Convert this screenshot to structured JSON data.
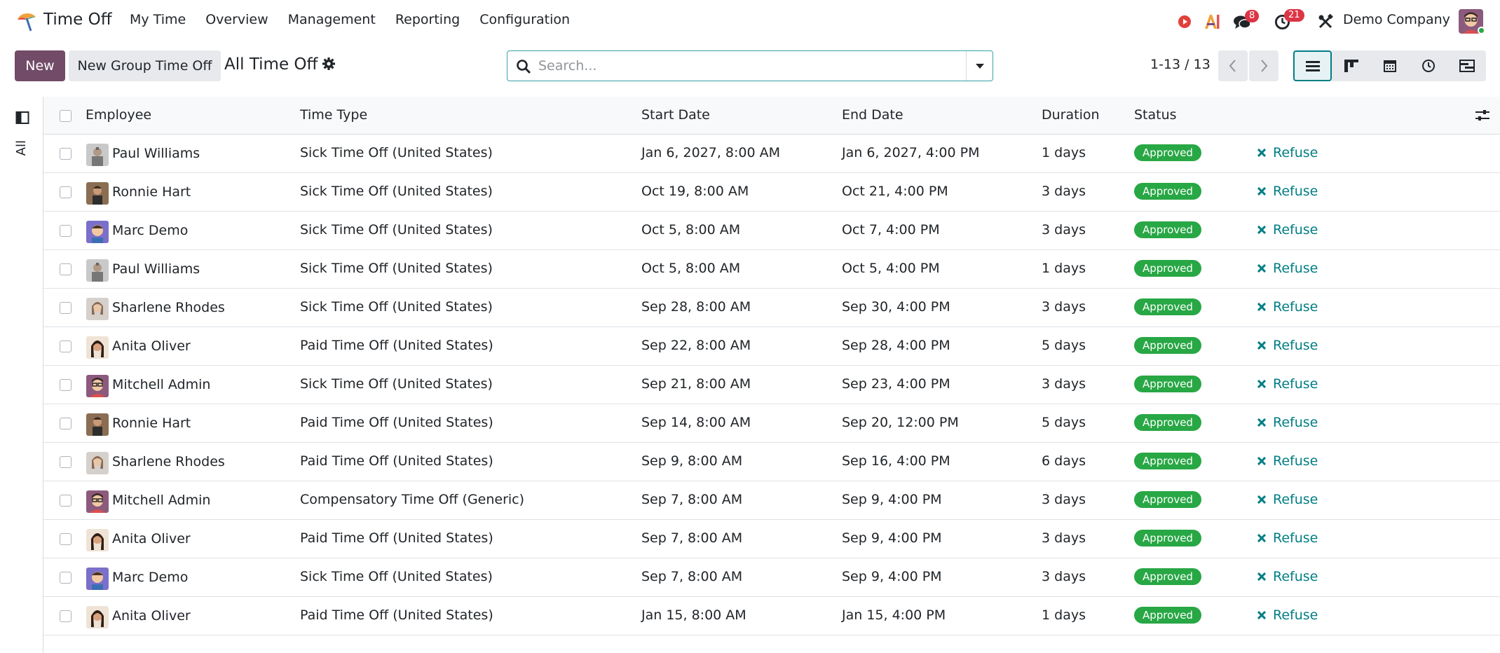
{
  "navbar": {
    "app_name": "Time Off",
    "menu": [
      "My Time",
      "Overview",
      "Management",
      "Reporting",
      "Configuration"
    ],
    "messages_count": "8",
    "activities_count": "21",
    "company": "Demo Company"
  },
  "control_panel": {
    "new_label": "New",
    "new_group_label": "New Group Time Off",
    "view_title": "All Time Off",
    "search_placeholder": "Search...",
    "pager": "1-13 / 13"
  },
  "sidepanel": {
    "label": "All"
  },
  "columns": {
    "employee": "Employee",
    "time_type": "Time Type",
    "start_date": "Start Date",
    "end_date": "End Date",
    "duration": "Duration",
    "status": "Status"
  },
  "rows": [
    {
      "employee": "Paul Williams",
      "avatar": "paul",
      "time_type": "Sick Time Off (United States)",
      "start": "Jan 6, 2027, 8:00 AM",
      "end": "Jan 6, 2027, 4:00 PM",
      "duration": "1 days",
      "status": "Approved",
      "action": "Refuse"
    },
    {
      "employee": "Ronnie Hart",
      "avatar": "ronnie",
      "time_type": "Sick Time Off (United States)",
      "start": "Oct 19, 8:00 AM",
      "end": "Oct 21, 4:00 PM",
      "duration": "3 days",
      "status": "Approved",
      "action": "Refuse"
    },
    {
      "employee": "Marc Demo",
      "avatar": "marc",
      "time_type": "Sick Time Off (United States)",
      "start": "Oct 5, 8:00 AM",
      "end": "Oct 7, 4:00 PM",
      "duration": "3 days",
      "status": "Approved",
      "action": "Refuse"
    },
    {
      "employee": "Paul Williams",
      "avatar": "paul",
      "time_type": "Sick Time Off (United States)",
      "start": "Oct 5, 8:00 AM",
      "end": "Oct 5, 4:00 PM",
      "duration": "1 days",
      "status": "Approved",
      "action": "Refuse"
    },
    {
      "employee": "Sharlene Rhodes",
      "avatar": "sharlene",
      "time_type": "Sick Time Off (United States)",
      "start": "Sep 28, 8:00 AM",
      "end": "Sep 30, 4:00 PM",
      "duration": "3 days",
      "status": "Approved",
      "action": "Refuse"
    },
    {
      "employee": "Anita Oliver",
      "avatar": "anita",
      "time_type": "Paid Time Off (United States)",
      "start": "Sep 22, 8:00 AM",
      "end": "Sep 28, 4:00 PM",
      "duration": "5 days",
      "status": "Approved",
      "action": "Refuse"
    },
    {
      "employee": "Mitchell Admin",
      "avatar": "mitchell",
      "time_type": "Sick Time Off (United States)",
      "start": "Sep 21, 8:00 AM",
      "end": "Sep 23, 4:00 PM",
      "duration": "3 days",
      "status": "Approved",
      "action": "Refuse"
    },
    {
      "employee": "Ronnie Hart",
      "avatar": "ronnie",
      "time_type": "Paid Time Off (United States)",
      "start": "Sep 14, 8:00 AM",
      "end": "Sep 20, 12:00 PM",
      "duration": "5 days",
      "status": "Approved",
      "action": "Refuse"
    },
    {
      "employee": "Sharlene Rhodes",
      "avatar": "sharlene",
      "time_type": "Paid Time Off (United States)",
      "start": "Sep 9, 8:00 AM",
      "end": "Sep 16, 4:00 PM",
      "duration": "6 days",
      "status": "Approved",
      "action": "Refuse"
    },
    {
      "employee": "Mitchell Admin",
      "avatar": "mitchell",
      "time_type": "Compensatory Time Off (Generic)",
      "start": "Sep 7, 8:00 AM",
      "end": "Sep 9, 4:00 PM",
      "duration": "3 days",
      "status": "Approved",
      "action": "Refuse"
    },
    {
      "employee": "Anita Oliver",
      "avatar": "anita",
      "time_type": "Paid Time Off (United States)",
      "start": "Sep 7, 8:00 AM",
      "end": "Sep 9, 4:00 PM",
      "duration": "3 days",
      "status": "Approved",
      "action": "Refuse"
    },
    {
      "employee": "Marc Demo",
      "avatar": "marc",
      "time_type": "Sick Time Off (United States)",
      "start": "Sep 7, 8:00 AM",
      "end": "Sep 9, 4:00 PM",
      "duration": "3 days",
      "status": "Approved",
      "action": "Refuse"
    },
    {
      "employee": "Anita Oliver",
      "avatar": "anita",
      "time_type": "Paid Time Off (United States)",
      "start": "Jan 15, 8:00 AM",
      "end": "Jan 15, 4:00 PM",
      "duration": "1 days",
      "status": "Approved",
      "action": "Refuse"
    }
  ],
  "colors": {
    "brand": "#714b67",
    "accent": "#017e84",
    "approved": "#28a745",
    "badge": "#dc3545"
  }
}
